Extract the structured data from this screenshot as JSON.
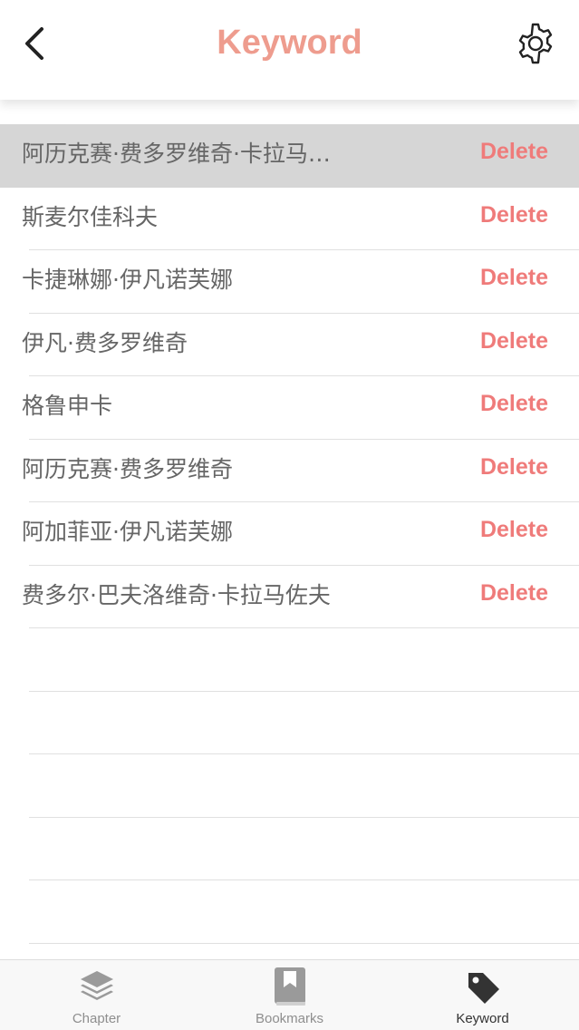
{
  "header": {
    "title": "Keyword"
  },
  "keywords": [
    {
      "label": "阿历克赛·费多罗维奇·卡拉马…",
      "delete_label": "Delete"
    },
    {
      "label": "斯麦尔佳科夫",
      "delete_label": "Delete"
    },
    {
      "label": "卡捷琳娜·伊凡诺芙娜",
      "delete_label": "Delete"
    },
    {
      "label": "伊凡·费多罗维奇",
      "delete_label": "Delete"
    },
    {
      "label": "格鲁申卡",
      "delete_label": "Delete"
    },
    {
      "label": "阿历克赛·费多罗维奇",
      "delete_label": "Delete"
    },
    {
      "label": "阿加菲亚·伊凡诺芙娜",
      "delete_label": "Delete"
    },
    {
      "label": "费多尔·巴夫洛维奇·卡拉马佐夫",
      "delete_label": "Delete"
    }
  ],
  "tabs": [
    {
      "label": "Chapter",
      "icon": "layers-icon",
      "active": false
    },
    {
      "label": "Bookmarks",
      "icon": "book-icon",
      "active": false
    },
    {
      "label": "Keyword",
      "icon": "tag-icon",
      "active": true
    }
  ],
  "colors": {
    "title": "#ee9c8e",
    "delete": "#ef7b7a",
    "selected_row": "#d6d6d6",
    "text": "#666666"
  }
}
